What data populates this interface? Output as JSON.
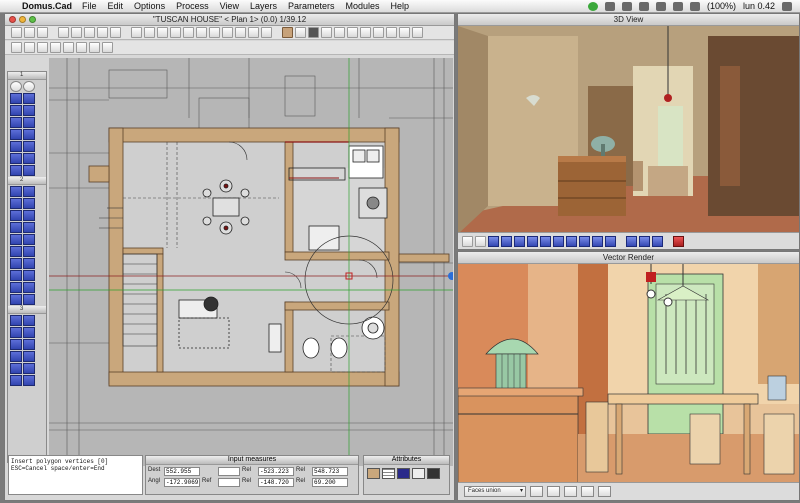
{
  "menubar": {
    "app": "Domus.Cad",
    "items": [
      "File",
      "Edit",
      "Options",
      "Process",
      "View",
      "Layers",
      "Parameters",
      "Modules",
      "Help"
    ],
    "battery": "(100%)",
    "clock": "lun 0.42"
  },
  "left_window": {
    "title": "\"TUSCAN HOUSE\" < Plan 1> (0.0) 1/39.12",
    "palette_sections": [
      "1",
      "2",
      "3"
    ],
    "command_lines": [
      "Insert polygon vertices [0]",
      "ESC=Cancel  space/enter=End"
    ],
    "measures": {
      "title": "Input measures",
      "rows": [
        {
          "label": "Dest",
          "v1": "552.955",
          "label2": "",
          "v2": "",
          "label3": "Rel",
          "v3": "-523.223",
          "label4": "Rel",
          "v4": "548.723"
        },
        {
          "label": "Angl",
          "v1": "-172.9069",
          "label2": "Ref",
          "v2": "",
          "label3": "Rel",
          "v3": "-148.720",
          "label4": "Rel",
          "v4": "69.200"
        }
      ]
    },
    "attributes": {
      "title": "Attributes"
    }
  },
  "view3d": {
    "title": "3D View"
  },
  "vector_render": {
    "title": "Vector Render",
    "mode_select": "Faces union"
  },
  "colors": {
    "wall": "#c9a77c",
    "plan_bg": "#b6b6b6",
    "room_floor": "#cfcfcf",
    "accent_blue": "#3448b4"
  }
}
